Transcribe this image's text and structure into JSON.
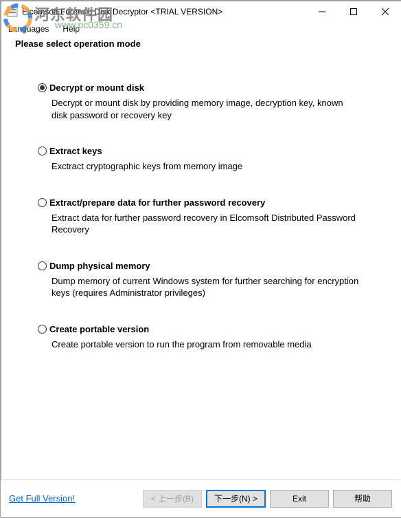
{
  "window": {
    "title": "Elcomsoft Forensic Disk Decryptor <TRIAL VERSION>"
  },
  "menu": {
    "languages": "Languages",
    "help": "Help"
  },
  "heading": "Please select operation mode",
  "options": [
    {
      "label": "Decrypt or mount disk",
      "desc": "Decrypt or mount disk by providing memory image, decryption key, known disk password or recovery key",
      "selected": true
    },
    {
      "label": "Extract keys",
      "desc": "Exctract cryptographic keys from memory image",
      "selected": false
    },
    {
      "label": "Extract/prepare data for further password recovery",
      "desc": "Extract data for further password recovery in Elcomsoft Distributed Password Recovery",
      "selected": false
    },
    {
      "label": "Dump physical memory",
      "desc": "Dump memory of current Windows system for further searching for encryption keys (requires Administrator privileges)",
      "selected": false
    },
    {
      "label": "Create portable version",
      "desc": "Create portable version to run the program from removable media",
      "selected": false
    }
  ],
  "footer": {
    "full_version_link": "Get Full Version!",
    "back": "< 上一步(B)",
    "next": "下一步(N) >",
    "exit": "Exit",
    "help": "帮助"
  },
  "watermark": {
    "site_cn": "河东软件园",
    "site_url": "www.pc0359.cn"
  }
}
